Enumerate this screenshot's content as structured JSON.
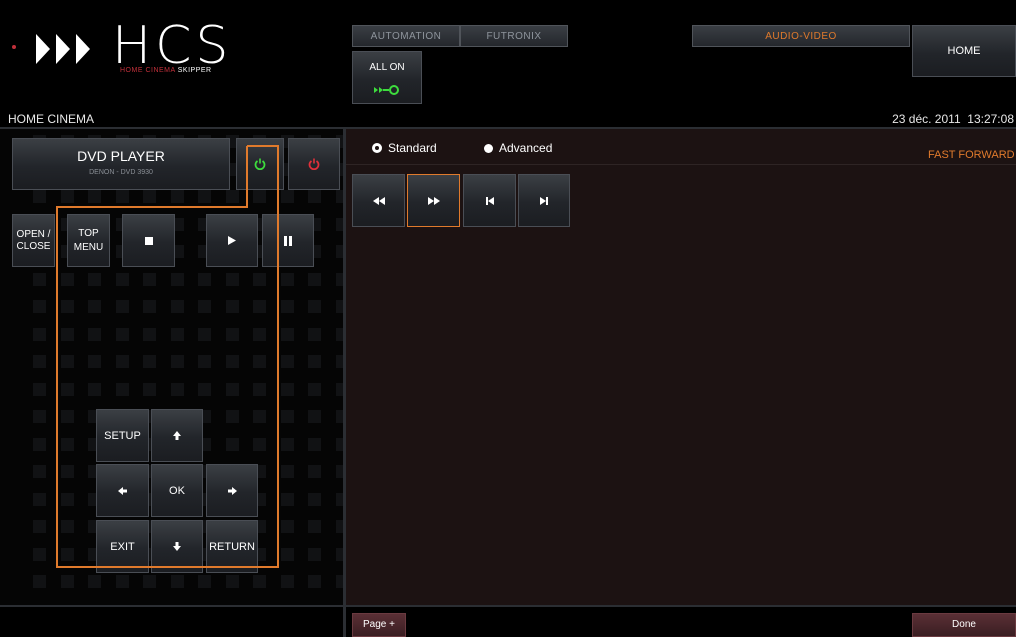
{
  "brand": {
    "logo_text": "HCS",
    "tagline_colored": "HOME CINEMA",
    "tagline_white": "SKIPPER"
  },
  "top_nav": {
    "automation": "AUTOMATION",
    "futronix": "FUTRONIX",
    "audio_video": "AUDIO-VIDEO",
    "home": "HOME",
    "all_on": "ALL ON"
  },
  "header": {
    "room": "HOME CINEMA",
    "datetime": "23 déc. 2011  13:27:08"
  },
  "device": {
    "name": "DVD PLAYER",
    "model": "DENON - DVD 3930"
  },
  "left_buttons": {
    "open_close": "OPEN / CLOSE",
    "top_menu": "TOP MENU",
    "setup": "SETUP",
    "ok": "OK",
    "exit": "EXIT",
    "return": "RETURN"
  },
  "mode": {
    "standard": "Standard",
    "advanced": "Advanced",
    "selected": "Standard"
  },
  "status_text": "FAST FORWARD",
  "footer": {
    "page_plus": "Page +",
    "done": "Done"
  },
  "colors": {
    "accent_orange": "#e07a2c",
    "power_on_green": "#3ddc3d",
    "power_off_red": "#e0303a",
    "panel_right": "#1c1212"
  },
  "icons": [
    "power-icon",
    "stop-icon",
    "play-icon",
    "pause-icon",
    "rewind-icon",
    "fast-forward-icon",
    "skip-previous-icon",
    "skip-next-icon",
    "arrow-up-icon",
    "arrow-down-icon",
    "arrow-left-icon",
    "arrow-right-icon",
    "all-on-icon"
  ]
}
